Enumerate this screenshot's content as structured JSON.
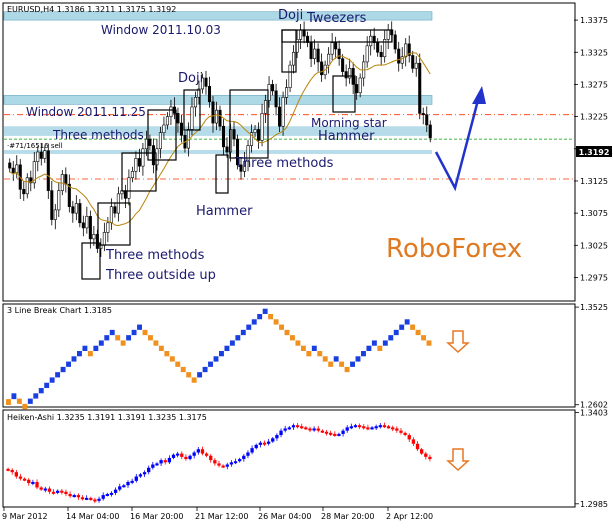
{
  "colors": {
    "bull": "#0000ff",
    "bear": "#ff0000",
    "brick_up": "#1a3fe0",
    "brick_down": "#f0901e",
    "window_band": "#add8e6",
    "level_line": "#ff3300",
    "current_line": "#009900",
    "ma_line": "#b8860b",
    "arrow": "#2233cc",
    "logo": "#e07a22",
    "down_arrow": "#e87722",
    "pattern_text": "#1a1a6e"
  },
  "chart_data": [
    {
      "type": "line",
      "title": "EURUSD,H4  1.3186 1.3211 1.3175 1.3192",
      "ylim": [
        1.294,
        1.34
      ],
      "y_ticks": [
        "1.3375",
        "1.3325",
        "1.3275",
        "1.3225",
        "1.3175",
        "1.3125",
        "1.3075",
        "1.3025",
        "1.2975"
      ],
      "current_price": "1.3192",
      "ma_label": "·#71/16516 sell",
      "levels": [
        1.3228,
        1.319,
        1.3128
      ],
      "windows": [
        {
          "label": "Window 2011.10.03",
          "from": 1.3375,
          "to": 1.3388
        },
        {
          "label": "Window 2011.11.25",
          "from": 1.3244,
          "to": 1.3258
        }
      ],
      "extra_bands": [
        [
          1.3195,
          1.321
        ],
        [
          1.3167,
          1.3173
        ]
      ],
      "patterns": [
        "Doji",
        "Tweezers",
        "Doji",
        "Morning star",
        "Hammer",
        "Three methods",
        "Three methods",
        "Hammer",
        "Three methods",
        "Three outside up"
      ],
      "logo": "RoboForex",
      "close": [
        1.3145,
        1.3138,
        1.315,
        1.3112,
        1.3105,
        1.313,
        1.3122,
        1.3155,
        1.317,
        1.316,
        1.3172,
        1.311,
        1.3065,
        1.308,
        1.311,
        1.3135,
        1.312,
        1.3085,
        1.3075,
        1.309,
        1.306,
        1.3052,
        1.307,
        1.3035,
        1.3042,
        1.302,
        1.3025,
        1.3045,
        1.306,
        1.3085,
        1.3075,
        1.3105,
        1.311,
        1.3098,
        1.313,
        1.314,
        1.316,
        1.3148,
        1.3175,
        1.319,
        1.318,
        1.315,
        1.3175,
        1.32,
        1.3212,
        1.3225,
        1.324,
        1.323,
        1.3215,
        1.3196,
        1.3176,
        1.3205,
        1.324,
        1.3255,
        1.3268,
        1.3285,
        1.3272,
        1.3248,
        1.3215,
        1.3235,
        1.321,
        1.3178,
        1.317,
        1.3205,
        1.319,
        1.315,
        1.314,
        1.3155,
        1.318,
        1.32,
        1.3205,
        1.3188,
        1.323,
        1.325,
        1.3275,
        1.3265,
        1.324,
        1.321,
        1.3255,
        1.327,
        1.3305,
        1.3325,
        1.3345,
        1.336,
        1.335,
        1.334,
        1.3315,
        1.333,
        1.331,
        1.329,
        1.3305,
        1.3322,
        1.334,
        1.333,
        1.3315,
        1.3295,
        1.3285,
        1.33,
        1.3275,
        1.3262,
        1.3285,
        1.331,
        1.3335,
        1.335,
        1.334,
        1.3325,
        1.3318,
        1.3345,
        1.336,
        1.3352,
        1.333,
        1.3308,
        1.3318,
        1.3338,
        1.332,
        1.33,
        1.3308,
        1.323,
        1.3228,
        1.3212,
        1.3192
      ],
      "x_ticks": [
        "9 Mar 2012",
        "14 Mar 04:00",
        "16 Mar 20:00",
        "21 Mar 12:00",
        "26 Mar 04:00",
        "28 Mar 20:00",
        "2 Apr 12:00"
      ]
    },
    {
      "type": "bar",
      "title": "3 Line Break Chart 1.3185",
      "ylim": [
        1.259,
        1.3545
      ],
      "y_ticks": [
        "1.3525",
        "1.2602"
      ],
      "bricks": [
        [
          1.26,
          1.2655,
          "d"
        ],
        [
          1.2655,
          1.271,
          "u"
        ],
        [
          1.261,
          1.266,
          "d"
        ],
        [
          1.256,
          1.261,
          "d"
        ],
        [
          1.261,
          1.266,
          "u"
        ],
        [
          1.266,
          1.271,
          "u"
        ],
        [
          1.271,
          1.276,
          "u"
        ],
        [
          1.276,
          1.281,
          "u"
        ],
        [
          1.281,
          1.286,
          "u"
        ],
        [
          1.286,
          1.291,
          "u"
        ],
        [
          1.291,
          1.296,
          "u"
        ],
        [
          1.296,
          1.301,
          "u"
        ],
        [
          1.301,
          1.306,
          "u"
        ],
        [
          1.306,
          1.311,
          "u"
        ],
        [
          1.311,
          1.316,
          "u"
        ],
        [
          1.306,
          1.311,
          "d"
        ],
        [
          1.311,
          1.316,
          "u"
        ],
        [
          1.316,
          1.321,
          "u"
        ],
        [
          1.321,
          1.326,
          "u"
        ],
        [
          1.326,
          1.331,
          "u"
        ],
        [
          1.321,
          1.326,
          "d"
        ],
        [
          1.316,
          1.321,
          "d"
        ],
        [
          1.321,
          1.326,
          "u"
        ],
        [
          1.326,
          1.331,
          "u"
        ],
        [
          1.331,
          1.336,
          "u"
        ],
        [
          1.326,
          1.331,
          "d"
        ],
        [
          1.321,
          1.326,
          "d"
        ],
        [
          1.316,
          1.321,
          "d"
        ],
        [
          1.311,
          1.316,
          "d"
        ],
        [
          1.306,
          1.311,
          "d"
        ],
        [
          1.301,
          1.306,
          "d"
        ],
        [
          1.296,
          1.301,
          "d"
        ],
        [
          1.291,
          1.296,
          "d"
        ],
        [
          1.286,
          1.291,
          "d"
        ],
        [
          1.281,
          1.286,
          "d"
        ],
        [
          1.286,
          1.291,
          "u"
        ],
        [
          1.291,
          1.296,
          "u"
        ],
        [
          1.296,
          1.301,
          "u"
        ],
        [
          1.301,
          1.306,
          "u"
        ],
        [
          1.306,
          1.311,
          "u"
        ],
        [
          1.311,
          1.316,
          "u"
        ],
        [
          1.316,
          1.321,
          "u"
        ],
        [
          1.321,
          1.326,
          "u"
        ],
        [
          1.326,
          1.331,
          "u"
        ],
        [
          1.331,
          1.336,
          "u"
        ],
        [
          1.336,
          1.341,
          "u"
        ],
        [
          1.341,
          1.346,
          "u"
        ],
        [
          1.346,
          1.351,
          "u"
        ],
        [
          1.341,
          1.346,
          "d"
        ],
        [
          1.336,
          1.341,
          "d"
        ],
        [
          1.331,
          1.336,
          "d"
        ],
        [
          1.326,
          1.331,
          "d"
        ],
        [
          1.321,
          1.326,
          "d"
        ],
        [
          1.316,
          1.321,
          "d"
        ],
        [
          1.311,
          1.316,
          "d"
        ],
        [
          1.306,
          1.311,
          "d"
        ],
        [
          1.311,
          1.316,
          "u"
        ],
        [
          1.306,
          1.311,
          "d"
        ],
        [
          1.301,
          1.306,
          "d"
        ],
        [
          1.296,
          1.301,
          "d"
        ],
        [
          1.301,
          1.306,
          "u"
        ],
        [
          1.296,
          1.301,
          "d"
        ],
        [
          1.291,
          1.296,
          "d"
        ],
        [
          1.296,
          1.301,
          "u"
        ],
        [
          1.301,
          1.306,
          "u"
        ],
        [
          1.306,
          1.311,
          "u"
        ],
        [
          1.311,
          1.316,
          "u"
        ],
        [
          1.316,
          1.321,
          "u"
        ],
        [
          1.311,
          1.316,
          "d"
        ],
        [
          1.316,
          1.321,
          "u"
        ],
        [
          1.321,
          1.326,
          "u"
        ],
        [
          1.326,
          1.331,
          "u"
        ],
        [
          1.331,
          1.336,
          "u"
        ],
        [
          1.336,
          1.341,
          "u"
        ],
        [
          1.331,
          1.336,
          "d"
        ],
        [
          1.326,
          1.331,
          "d"
        ],
        [
          1.321,
          1.326,
          "d"
        ],
        [
          1.316,
          1.321,
          "d"
        ]
      ]
    },
    {
      "type": "line",
      "title": "Heiken-Ashi 1.3235 1.3191 1.3191 1.3235 1.3175",
      "ylim": [
        1.2975,
        1.341
      ],
      "y_ticks": [
        "1.3403",
        "1.2985"
      ],
      "close": [
        1.314,
        1.313,
        1.311,
        1.31,
        1.3095,
        1.308,
        1.3085,
        1.306,
        1.305,
        1.3055,
        1.304,
        1.3035,
        1.3045,
        1.304,
        1.303,
        1.302,
        1.3025,
        1.3015,
        1.301,
        1.3012,
        1.3005,
        1.3,
        1.3008,
        1.3025,
        1.303,
        1.3035,
        1.305,
        1.3065,
        1.307,
        1.3085,
        1.309,
        1.311,
        1.312,
        1.313,
        1.315,
        1.3165,
        1.317,
        1.3185,
        1.3175,
        1.3195,
        1.321,
        1.3215,
        1.32,
        1.319,
        1.3205,
        1.322,
        1.3235,
        1.3215,
        1.3205,
        1.3185,
        1.317,
        1.316,
        1.3155,
        1.3165,
        1.3175,
        1.318,
        1.319,
        1.3205,
        1.322,
        1.324,
        1.3255,
        1.3265,
        1.326,
        1.327,
        1.3285,
        1.33,
        1.332,
        1.333,
        1.3335,
        1.3345,
        1.334,
        1.3335,
        1.333,
        1.3325,
        1.333,
        1.332,
        1.3315,
        1.331,
        1.3305,
        1.33,
        1.3305,
        1.332,
        1.3335,
        1.334,
        1.3345,
        1.334,
        1.3335,
        1.333,
        1.3335,
        1.334,
        1.3345,
        1.334,
        1.3335,
        1.333,
        1.332,
        1.331,
        1.33,
        1.328,
        1.326,
        1.3235,
        1.3215,
        1.32,
        1.319
      ],
      "x_ticks": [
        "9 Mar 2012",
        "14 Mar 04:00",
        "16 Mar 20:00",
        "21 Mar 12:00",
        "26 Mar 04:00",
        "28 Mar 20:00",
        "2 Apr 12:00"
      ]
    }
  ]
}
